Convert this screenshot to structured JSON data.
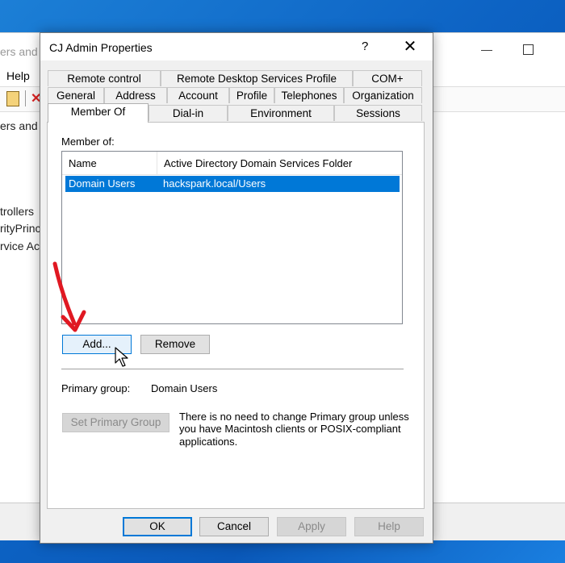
{
  "background_window": {
    "title_fragment": "ers and",
    "menu_help": "Help",
    "tree_fragments": [
      "ers and C",
      "trollers",
      "rityPrinc",
      "rvice Ac"
    ]
  },
  "dialog": {
    "title": "CJ Admin Properties",
    "help_glyph": "?",
    "close_glyph": "✕",
    "tabs_row1": [
      "Remote control",
      "Remote Desktop Services Profile",
      "COM+"
    ],
    "tabs_row2": [
      "General",
      "Address",
      "Account",
      "Profile",
      "Telephones",
      "Organization"
    ],
    "tabs_row3": [
      "Member Of",
      "Dial-in",
      "Environment",
      "Sessions"
    ],
    "active_tab": "Member Of",
    "member_of_label": "Member of:",
    "list": {
      "columns": [
        "Name",
        "Active Directory Domain Services Folder"
      ],
      "rows": [
        {
          "name": "Domain Users",
          "folder": "hackspark.local/Users",
          "selected": true
        }
      ]
    },
    "add_button": "Add...",
    "remove_button": "Remove",
    "primary_group_label": "Primary group:",
    "primary_group_value": "Domain Users",
    "set_primary_button": "Set Primary Group",
    "primary_group_note": [
      "There is no need to change Primary group unless",
      "you have Macintosh clients or POSIX-compliant",
      "applications."
    ],
    "footer_buttons": {
      "ok": "OK",
      "cancel": "Cancel",
      "apply": "Apply",
      "help": "Help"
    }
  },
  "colors": {
    "selection": "#0078d7",
    "annotation_arrow": "#e01822",
    "desktop": "#0d63c4"
  },
  "icons": [
    "cursor-icon",
    "annotation-arrow-icon",
    "clipboard-icon",
    "delete-icon"
  ]
}
